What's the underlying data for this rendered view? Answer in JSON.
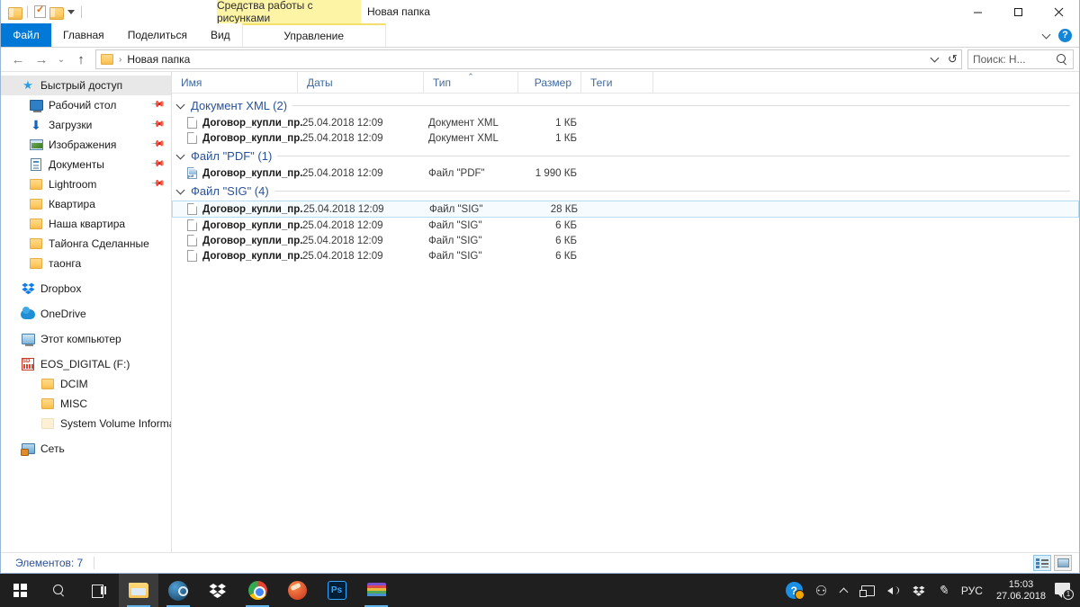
{
  "window": {
    "title": "Новая папка",
    "contextual_tab_group": "Средства работы с рисунками",
    "minimize": "—",
    "maximize": "□",
    "close": "✕"
  },
  "quick_access_toolbar": {
    "items": [
      {
        "name": "new-folder-icon",
        "label": ""
      },
      {
        "name": "properties-icon",
        "label": ""
      },
      {
        "name": "folder-icon",
        "label": ""
      },
      {
        "name": "customize-dropdown-icon",
        "label": ""
      }
    ]
  },
  "ribbon": {
    "tabs": [
      {
        "label": "Файл",
        "id": "file",
        "active": false
      },
      {
        "label": "Главная",
        "id": "home",
        "active": false
      },
      {
        "label": "Поделиться",
        "id": "share",
        "active": false
      },
      {
        "label": "Вид",
        "id": "view",
        "active": false
      },
      {
        "label": "Управление",
        "id": "manage",
        "active": true
      }
    ],
    "collapse_label": "",
    "help_label": "?"
  },
  "address": {
    "back": "←",
    "forward": "→",
    "recent": "⌄",
    "up": "↑",
    "crumb_separator": "›",
    "crumb": "Новая папка",
    "dropdown": "",
    "refresh": "↻"
  },
  "search": {
    "placeholder": "Поиск: Н...",
    "icon": "search-icon"
  },
  "sidebar": {
    "items": [
      {
        "label": "Быстрый доступ",
        "icon": "star-icon",
        "level": 0,
        "selected": true,
        "pinned": false
      },
      {
        "label": "Рабочий стол",
        "icon": "desktop-icon",
        "level": 1,
        "selected": false,
        "pinned": true
      },
      {
        "label": "Загрузки",
        "icon": "downloads-icon",
        "level": 1,
        "selected": false,
        "pinned": true
      },
      {
        "label": "Изображения",
        "icon": "pictures-icon",
        "level": 1,
        "selected": false,
        "pinned": true
      },
      {
        "label": "Документы",
        "icon": "documents-icon",
        "level": 1,
        "selected": false,
        "pinned": true
      },
      {
        "label": "Lightroom",
        "icon": "folder-icon",
        "level": 1,
        "selected": false,
        "pinned": true
      },
      {
        "label": "Квартира",
        "icon": "folder-icon",
        "level": 1,
        "selected": false,
        "pinned": false
      },
      {
        "label": "Наша квартира",
        "icon": "folder-icon",
        "level": 1,
        "selected": false,
        "pinned": false
      },
      {
        "label": "Тайонга Сделанные",
        "icon": "folder-icon",
        "level": 1,
        "selected": false,
        "pinned": false
      },
      {
        "label": "таонга",
        "icon": "folder-icon",
        "level": 1,
        "selected": false,
        "pinned": false
      },
      {
        "label": "Dropbox",
        "icon": "dropbox-icon",
        "level": 0,
        "selected": false,
        "pinned": false,
        "gap_before": true
      },
      {
        "label": "OneDrive",
        "icon": "onedrive-icon",
        "level": 0,
        "selected": false,
        "pinned": false,
        "gap_before": true
      },
      {
        "label": "Этот компьютер",
        "icon": "this-pc-icon",
        "level": 0,
        "selected": false,
        "pinned": false,
        "gap_before": true
      },
      {
        "label": "EOS_DIGITAL (F:)",
        "icon": "sd-card-icon",
        "level": 0,
        "selected": false,
        "pinned": false,
        "gap_before": true
      },
      {
        "label": "DCIM",
        "icon": "folder-icon",
        "level": 1,
        "selected": false,
        "pinned": false
      },
      {
        "label": "MISC",
        "icon": "folder-icon",
        "level": 1,
        "selected": false,
        "pinned": false
      },
      {
        "label": "System Volume Information",
        "icon": "folder-icon-pale",
        "level": 1,
        "selected": false,
        "pinned": false
      },
      {
        "label": "Сеть",
        "icon": "network-icon",
        "level": 0,
        "selected": false,
        "pinned": false,
        "gap_before": true
      }
    ]
  },
  "file_list": {
    "columns": [
      {
        "label": "Имя",
        "key": "name",
        "sorted": false
      },
      {
        "label": "Даты",
        "key": "date",
        "sorted": false
      },
      {
        "label": "Тип",
        "key": "type",
        "sorted": true,
        "sort_mark": "⌃"
      },
      {
        "label": "Размер",
        "key": "size",
        "sorted": false
      },
      {
        "label": "Теги",
        "key": "tags",
        "sorted": false
      }
    ],
    "groups": [
      {
        "header": "Документ XML (2)",
        "expanded": true,
        "rows": [
          {
            "name": "Договор_купли_пр...",
            "date": "25.04.2018 12:09",
            "type": "Документ XML",
            "size": "1 КБ",
            "icon": "generic-file-icon",
            "selected": false
          },
          {
            "name": "Договор_купли_пр...",
            "date": "25.04.2018 12:09",
            "type": "Документ XML",
            "size": "1 КБ",
            "icon": "generic-file-icon",
            "selected": false
          }
        ]
      },
      {
        "header": "Файл \"PDF\" (1)",
        "expanded": true,
        "rows": [
          {
            "name": "Договор_купли_пр...",
            "date": "25.04.2018 12:09",
            "type": "Файл \"PDF\"",
            "size": "1 990 КБ",
            "icon": "pdf-file-icon",
            "selected": false
          }
        ]
      },
      {
        "header": "Файл \"SIG\" (4)",
        "expanded": true,
        "rows": [
          {
            "name": "Договор_купли_пр...",
            "date": "25.04.2018 12:09",
            "type": "Файл \"SIG\"",
            "size": "28 КБ",
            "icon": "generic-file-icon",
            "selected": true
          },
          {
            "name": "Договор_купли_пр...",
            "date": "25.04.2018 12:09",
            "type": "Файл \"SIG\"",
            "size": "6 КБ",
            "icon": "generic-file-icon",
            "selected": false
          },
          {
            "name": "Договор_купли_пр...",
            "date": "25.04.2018 12:09",
            "type": "Файл \"SIG\"",
            "size": "6 КБ",
            "icon": "generic-file-icon",
            "selected": false
          },
          {
            "name": "Договор_купли_пр...",
            "date": "25.04.2018 12:09",
            "type": "Файл \"SIG\"",
            "size": "6 КБ",
            "icon": "generic-file-icon",
            "selected": false
          }
        ]
      }
    ]
  },
  "status_bar": {
    "items_count": "Элементов: 7",
    "view_details": "details-view-button",
    "view_large": "large-icons-view-button"
  },
  "taskbar": {
    "buttons": [
      {
        "name": "start-button",
        "icon": "windows-logo-icon"
      },
      {
        "name": "search-button",
        "icon": "search-icon"
      },
      {
        "name": "task-view-button",
        "icon": "task-view-icon"
      },
      {
        "name": "file-explorer-button",
        "icon": "file-explorer-icon",
        "active": true
      },
      {
        "name": "steam-button",
        "icon": "steam-icon",
        "running": true
      },
      {
        "name": "dropbox-button",
        "icon": "dropbox-icon"
      },
      {
        "name": "chrome-button",
        "icon": "chrome-icon",
        "running": true
      },
      {
        "name": "ccleaner-button",
        "icon": "ccleaner-icon"
      },
      {
        "name": "photoshop-button",
        "icon": "photoshop-icon",
        "label": "Ps"
      },
      {
        "name": "winrar-button",
        "icon": "winrar-icon",
        "running": true
      }
    ],
    "tray": {
      "help": "?",
      "people": "people-icon",
      "show_hidden": "chevron-up-icon",
      "network": "network-icon",
      "volume": "volume-icon",
      "dropbox": "dropbox-tray-icon",
      "pen": "pen-icon",
      "language": "РУС",
      "time": "15:03",
      "date": "27.06.2018",
      "notification_count": "1"
    }
  },
  "colors": {
    "accent_blue": "#0078d7",
    "contextual_yellow": "#fdf4a6",
    "group_header_blue": "#2a5298",
    "column_header_blue": "#41699e",
    "selection_fill": "#f6fbfe",
    "selection_border": "#b7dcf3",
    "taskbar_bg": "#1f1f1f"
  }
}
